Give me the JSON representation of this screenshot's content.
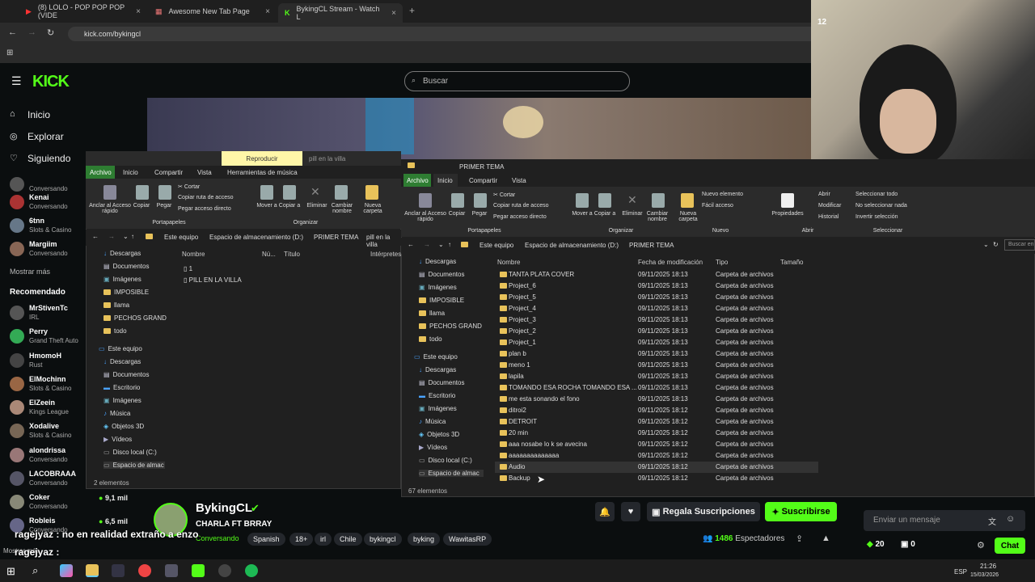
{
  "browser": {
    "tabs": [
      {
        "label": "(8) LOLO - POP POP POP (VIDE"
      },
      {
        "label": "Awesome New Tab Page"
      },
      {
        "label": "BykingCL Stream - Watch L"
      }
    ],
    "url": "kick.com/bykingcl"
  },
  "kick": {
    "search_placeholder": "Buscar",
    "nav": {
      "inicio": "Inicio",
      "explorar": "Explorar",
      "siguiendo": "Siguiendo",
      "mostrar_mas": "Mostrar más",
      "recomendado": "Recomendado",
      "mostrar_mas2": "Mostrar más"
    },
    "following": [
      {
        "name": "",
        "sub": "Conversando"
      },
      {
        "name": "Kenai",
        "sub": "Conversando"
      },
      {
        "name": "6tnn",
        "sub": "Slots & Casino"
      },
      {
        "name": "Margiim",
        "sub": "Conversando"
      }
    ],
    "recommended": [
      {
        "name": "MrStivenTc",
        "sub": "IRL"
      },
      {
        "name": "Perry",
        "sub": "Grand Theft Auto"
      },
      {
        "name": "HmomoH",
        "sub": "Rust"
      },
      {
        "name": "ElMochinn",
        "sub": "Slots & Casino"
      },
      {
        "name": "ElZeein",
        "sub": "Kings League"
      },
      {
        "name": "Xodalive",
        "sub": "Slots & Casino"
      },
      {
        "name": "alondrissa",
        "sub": "Conversando"
      },
      {
        "name": "LACOBRAAA",
        "sub": "Conversando"
      },
      {
        "name": "Coker",
        "sub": "Conversando"
      },
      {
        "name": "Robleis",
        "sub": "Conversando"
      }
    ],
    "viewer_counts": {
      "a": "9,1 mil",
      "b": "6,5 mil"
    },
    "streamer": "BykingCL",
    "stream_title": "CHARLA FT BRRAY",
    "category": "Conversando",
    "tags": [
      "Spanish",
      "18+",
      "irl",
      "Chile",
      "bykingcl",
      "byking",
      "WawitasRP"
    ],
    "chat_overlay": "ragejyaz : no en realidad extraño a enzo",
    "chat_overlay2": "ragejyaz :",
    "subs_button": "Regala Suscripciones",
    "subscribe_button": "Suscribirse",
    "viewers": "1486",
    "viewers_label": "Espectadores",
    "chat_placeholder": "Enviar un mensaje",
    "points": "20",
    "gifts": "0",
    "chat_button": "Chat"
  },
  "explorer_left": {
    "title": "pill en la villa",
    "contextual_tab": "Reproducir",
    "tabs": [
      "Archivo",
      "Inicio",
      "Compartir",
      "Vista",
      "Herramientas de música"
    ],
    "path": [
      "Este equipo",
      "Espacio de almacenamiento (D:)",
      "PRIMER TEMA",
      "pill en la villa"
    ],
    "columns": [
      "Nombre",
      "Nú...",
      "Título",
      "Intérpretes"
    ],
    "nav": [
      "Descargas",
      "Documentos",
      "Imágenes",
      "IMPOSIBLE",
      "llama",
      "PECHOS GRAND",
      "todo",
      "Este equipo",
      "Descargas",
      "Documentos",
      "Escritorio",
      "Imágenes",
      "Música",
      "Objetos 3D",
      "Vídeos",
      "Disco local (C:)",
      "Espacio de almac"
    ],
    "files": [
      "1",
      "PILL EN LA VILLA"
    ],
    "status": "2 elementos",
    "ribbon": {
      "pin": "Anclar al Acceso rápido",
      "copy": "Copiar",
      "paste": "Pegar",
      "cut": "Cortar",
      "copy_path": "Copiar ruta de acceso",
      "paste_shortcut": "Pegar acceso directo",
      "move": "Mover a",
      "copy_to": "Copiar a",
      "delete": "Eliminar",
      "rename": "Cambiar nombre",
      "new_folder": "Nueva carpeta",
      "group_clip": "Portapapeles",
      "group_org": "Organizar"
    }
  },
  "explorer_right": {
    "title": "PRIMER TEMA",
    "tabs": [
      "Archivo",
      "Inicio",
      "Compartir",
      "Vista"
    ],
    "path": [
      "Este equipo",
      "Espacio de almacenamiento (D:)",
      "PRIMER TEMA"
    ],
    "search_placeholder": "Buscar en",
    "columns": [
      "Nombre",
      "Fecha de modificación",
      "Tipo",
      "Tamaño"
    ],
    "nav": [
      "Descargas",
      "Documentos",
      "Imágenes",
      "IMPOSIBLE",
      "llama",
      "PECHOS GRAND",
      "todo",
      "Este equipo",
      "Descargas",
      "Documentos",
      "Escritorio",
      "Imágenes",
      "Música",
      "Objetos 3D",
      "Vídeos",
      "Disco local (C:)",
      "Espacio de almac"
    ],
    "ribbon": {
      "pin": "Anclar al Acceso rápido",
      "copy": "Copiar",
      "paste": "Pegar",
      "cut": "Cortar",
      "copy_path": "Copiar ruta de acceso",
      "paste_shortcut": "Pegar acceso directo",
      "move": "Mover a",
      "copy_to": "Copiar a",
      "delete": "Eliminar",
      "rename": "Cambiar nombre",
      "new_folder": "Nueva carpeta",
      "new_item": "Nuevo elemento",
      "easy_access": "Fácil acceso",
      "properties": "Propiedades",
      "open": "Abrir",
      "modify": "Modificar",
      "history": "Historial",
      "select_all": "Seleccionar todo",
      "select_none": "No seleccionar nada",
      "invert": "Invertir selección",
      "group_clip": "Portapapeles",
      "group_org": "Organizar",
      "group_new": "Nuevo",
      "group_open": "Abrir",
      "group_sel": "Seleccionar"
    },
    "files": [
      {
        "name": "TANTA PLATA COVER",
        "date": "09/11/2025 18:13",
        "type": "Carpeta de archivos"
      },
      {
        "name": "Project_6",
        "date": "09/11/2025 18:13",
        "type": "Carpeta de archivos"
      },
      {
        "name": "Project_5",
        "date": "09/11/2025 18:13",
        "type": "Carpeta de archivos"
      },
      {
        "name": "Project_4",
        "date": "09/11/2025 18:13",
        "type": "Carpeta de archivos"
      },
      {
        "name": "Project_3",
        "date": "09/11/2025 18:13",
        "type": "Carpeta de archivos"
      },
      {
        "name": "Project_2",
        "date": "09/11/2025 18:13",
        "type": "Carpeta de archivos"
      },
      {
        "name": "Project_1",
        "date": "09/11/2025 18:13",
        "type": "Carpeta de archivos"
      },
      {
        "name": "plan b",
        "date": "09/11/2025 18:13",
        "type": "Carpeta de archivos"
      },
      {
        "name": "meno 1",
        "date": "09/11/2025 18:13",
        "type": "Carpeta de archivos"
      },
      {
        "name": "lapila",
        "date": "09/11/2025 18:13",
        "type": "Carpeta de archivos"
      },
      {
        "name": "TOMANDO ESA ROCHA TOMANDO ESA ...",
        "date": "09/11/2025 18:13",
        "type": "Carpeta de archivos"
      },
      {
        "name": "me esta sonando el fono",
        "date": "09/11/2025 18:13",
        "type": "Carpeta de archivos"
      },
      {
        "name": "ditroi2",
        "date": "09/11/2025 18:12",
        "type": "Carpeta de archivos"
      },
      {
        "name": "DETROIT",
        "date": "09/11/2025 18:12",
        "type": "Carpeta de archivos"
      },
      {
        "name": "20 min",
        "date": "09/11/2025 18:12",
        "type": "Carpeta de archivos"
      },
      {
        "name": "aaa nosabe lo k se avecina",
        "date": "09/11/2025 18:12",
        "type": "Carpeta de archivos"
      },
      {
        "name": "aaaaaaaaaaaaaa",
        "date": "09/11/2025 18:12",
        "type": "Carpeta de archivos"
      },
      {
        "name": "Audio",
        "date": "09/11/2025 18:12",
        "type": "Carpeta de archivos"
      },
      {
        "name": "Backup",
        "date": "09/11/2025 18:12",
        "type": "Carpeta de archivos"
      }
    ],
    "status": "67 elementos"
  },
  "taskbar": {
    "lang": "ESP",
    "time": "21:26",
    "date": "15/03/2026"
  },
  "webcam_badge": "12",
  "colors": {
    "kick_green": "#53fc18",
    "explorer_bg": "#202020",
    "contextual": "#fff6a8"
  }
}
